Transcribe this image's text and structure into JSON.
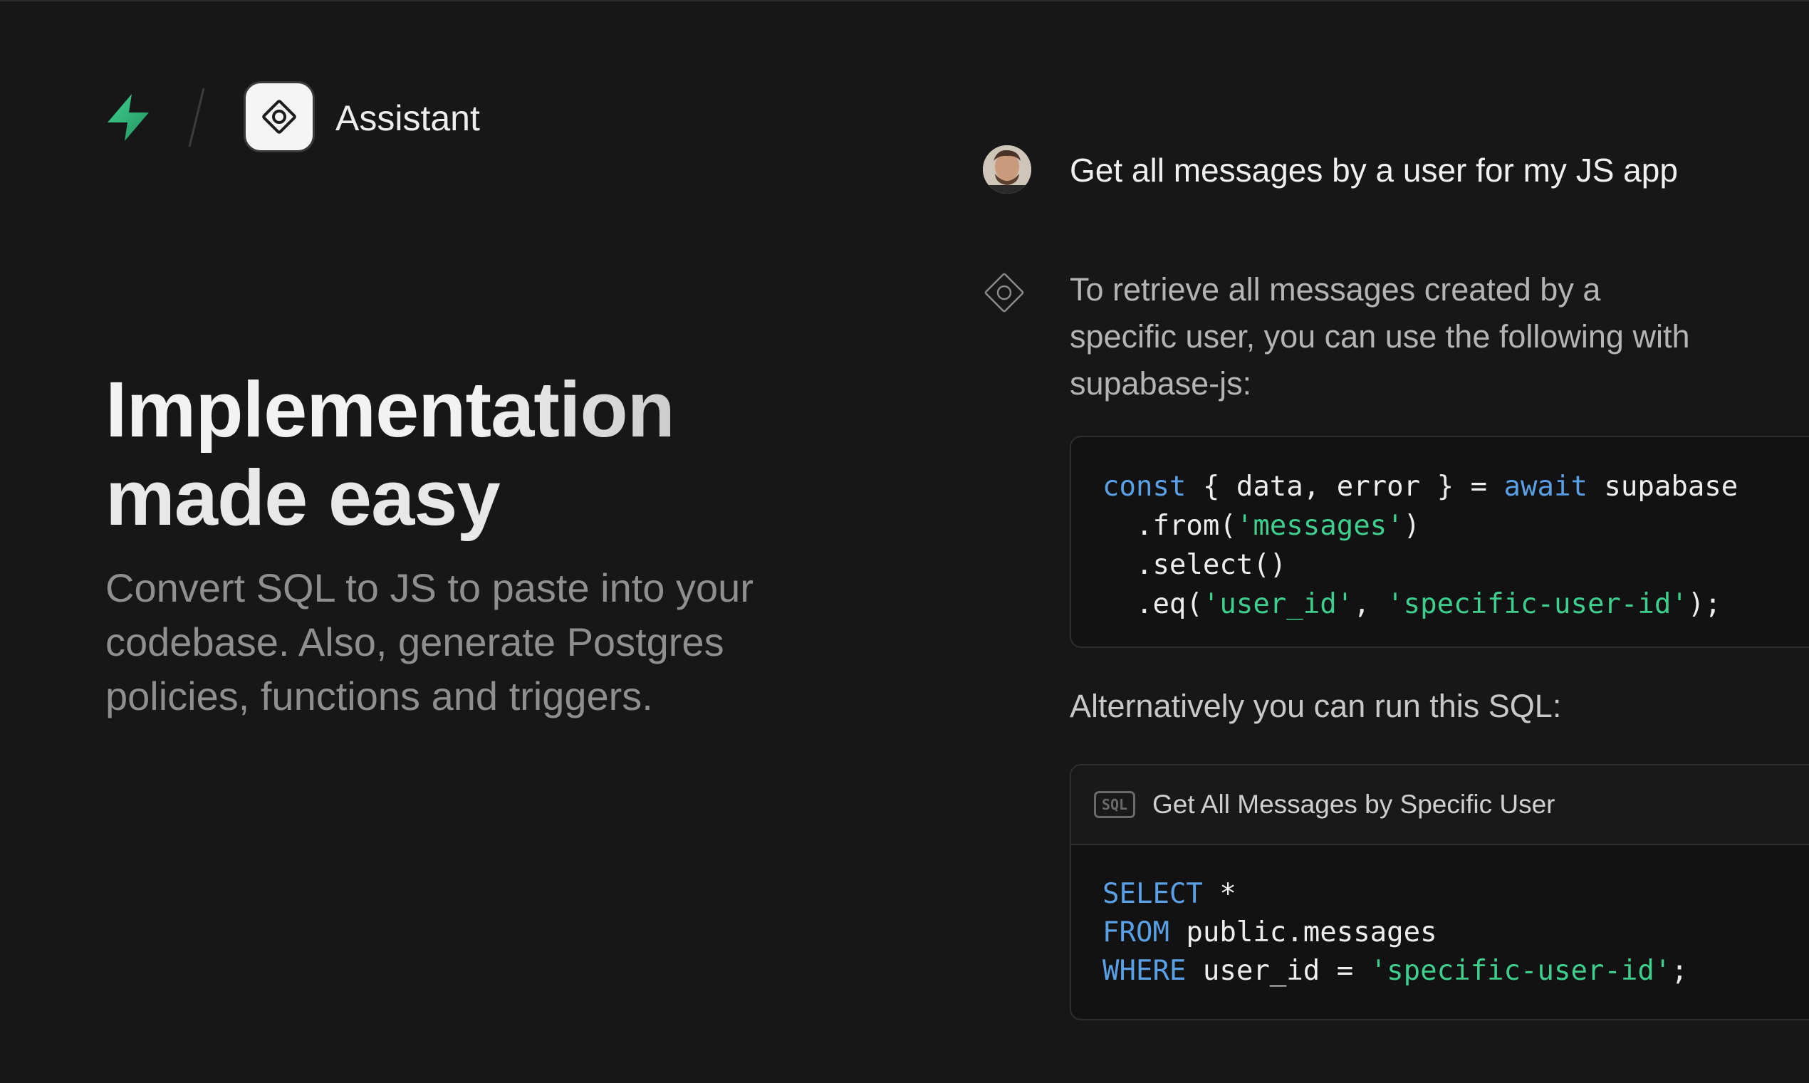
{
  "header": {
    "brand_icon": "supabase-bolt-icon",
    "product_icon": "assistant-diamond-icon",
    "title": "Assistant"
  },
  "hero": {
    "title_line1": "Implementation",
    "title_line2": "made easy",
    "subtitle": "Convert SQL to JS to paste into your codebase. Also, generate Postgres policies, functions and triggers."
  },
  "chat": {
    "user_message": "Get all messages by a user for my JS app",
    "assistant_message": "To retrieve all messages created by a specific user, you can use the following with supabase-js:",
    "js_code": {
      "line1": {
        "kw1": "const",
        "mid": " { data, error } = ",
        "kw2": "await",
        "tail": " supabase"
      },
      "line2": {
        "pre": "  .from(",
        "str": "'messages'",
        "post": ")"
      },
      "line3": "  .select()",
      "line4": {
        "pre": "  .eq(",
        "str1": "'user_id'",
        "sep": ", ",
        "str2": "'specific-user-id'",
        "post": ");"
      }
    },
    "alternative_text": "Alternatively you can run this SQL:",
    "sql_card": {
      "badge": "SQL",
      "title": "Get All Messages by Specific User",
      "line1": {
        "kw": "SELECT",
        "rest": " *"
      },
      "line2": {
        "kw": "FROM",
        "rest": " public.messages"
      },
      "line3": {
        "kw": "WHERE",
        "mid": " user_id = ",
        "str": "'specific-user-id'",
        "post": ";"
      }
    }
  },
  "colors": {
    "background": "#171717",
    "brand_green": "#3ecf8e",
    "keyword_blue": "#5aa0e6",
    "string_green": "#3ecf8e"
  }
}
